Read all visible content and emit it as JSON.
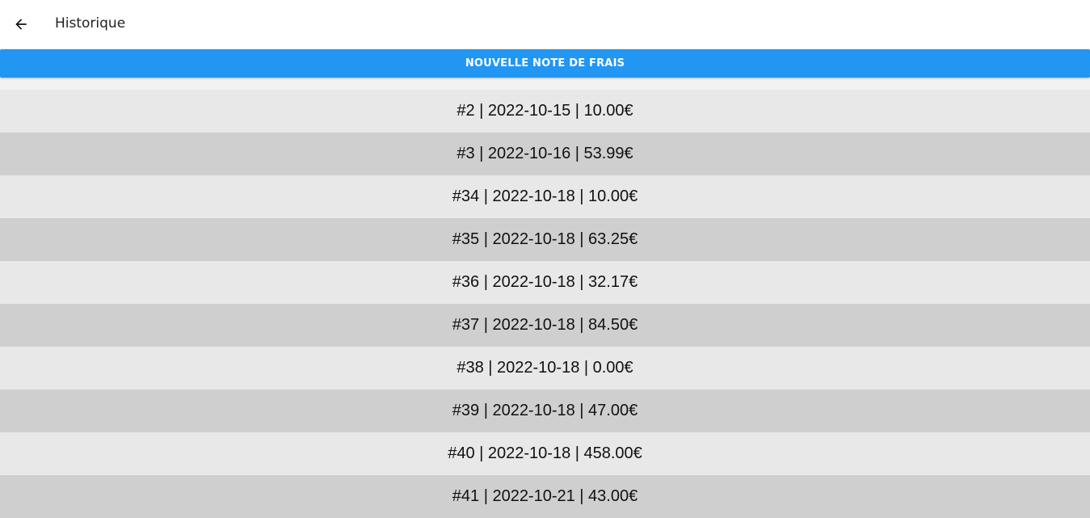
{
  "header": {
    "title": "Historique",
    "back_icon": "arrow-left-icon"
  },
  "actions": {
    "new_expense_label": "NOUVELLE NOTE DE FRAIS"
  },
  "colors": {
    "primary": "#2196f3",
    "row_light": "#e8e8e8",
    "row_dark": "#cfcfcf"
  },
  "history": {
    "items": [
      "#2 | 2022-10-15 | 10.00€",
      "#3 | 2022-10-16 | 53.99€",
      "#34 | 2022-10-18 | 10.00€",
      "#35 | 2022-10-18 | 63.25€",
      "#36 | 2022-10-18 | 32.17€",
      "#37 | 2022-10-18 | 84.50€",
      "#38 | 2022-10-18 | 0.00€",
      "#39 | 2022-10-18 | 47.00€",
      "#40 | 2022-10-18 | 458.00€",
      "#41 | 2022-10-21 | 43.00€"
    ]
  }
}
